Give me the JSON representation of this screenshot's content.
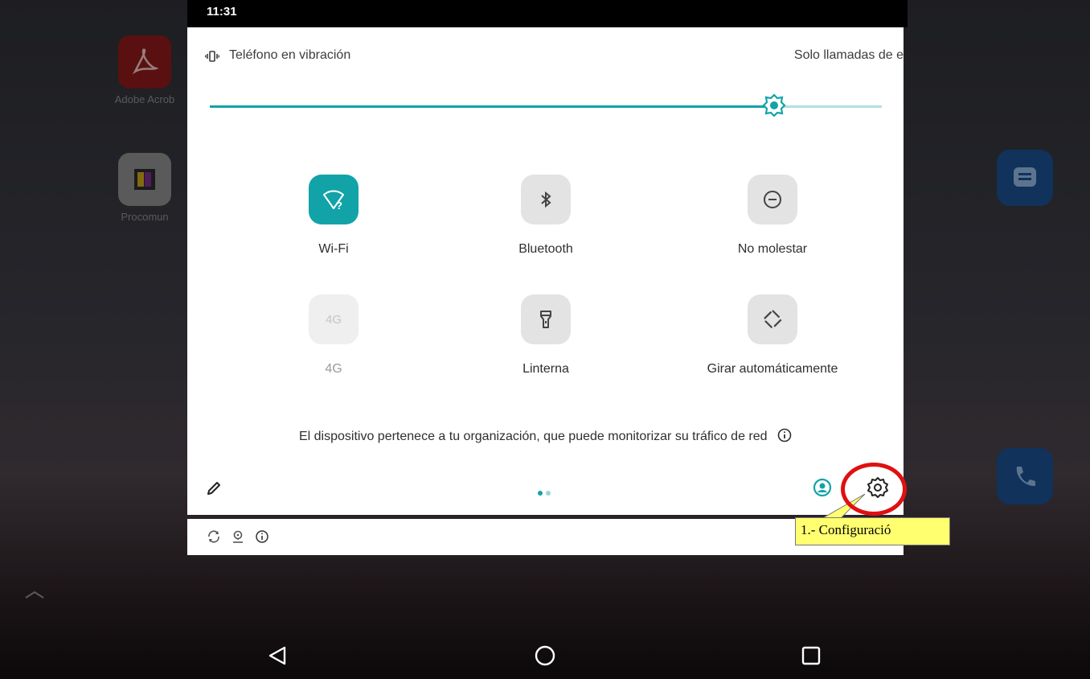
{
  "status_bar": {
    "time": "11:31"
  },
  "home_apps": [
    {
      "label": "Adobe Acrob"
    },
    {
      "label": "Procomun"
    }
  ],
  "quick_settings": {
    "ringer_label": "Teléfono en vibración",
    "calls_label": "Solo llamadas de e",
    "brightness_level": 0.84,
    "tiles": [
      {
        "label": "Wi-Fi",
        "icon": "wifi-unknown-icon",
        "state": "on"
      },
      {
        "label": "Bluetooth",
        "icon": "bluetooth-icon",
        "state": "off"
      },
      {
        "label": "No molestar",
        "icon": "do-not-disturb-icon",
        "state": "off"
      },
      {
        "label": "4G",
        "icon": "mobile-data-icon",
        "state": "unavailable",
        "icon_text": "4G"
      },
      {
        "label": "Linterna",
        "icon": "flashlight-icon",
        "state": "off"
      },
      {
        "label": "Girar automáticamente",
        "icon": "auto-rotate-icon",
        "state": "off"
      }
    ],
    "org_notice": "El dispositivo pertenece a tu organización, que puede monitorizar su tráfico de red",
    "page_count": 2,
    "current_page": 1
  },
  "annotation": {
    "label": "1.- Configuració"
  },
  "colors": {
    "accent": "#12a3a8",
    "annotation_red": "#e01010",
    "callout_bg": "#ffff70"
  }
}
